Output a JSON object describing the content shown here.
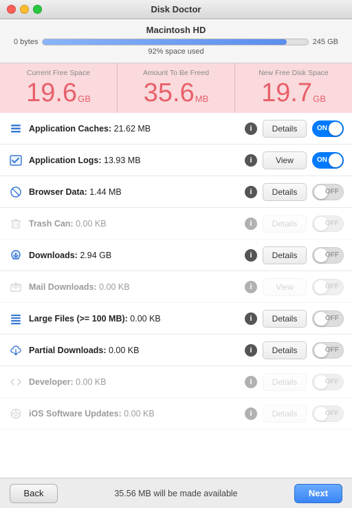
{
  "titlebar": {
    "title": "Disk Doctor"
  },
  "disk": {
    "name": "Macintosh HD",
    "label_left": "0 bytes",
    "label_right": "245 GB",
    "used_percent": 92,
    "used_label": "92% space used",
    "fill_width": "92%"
  },
  "stats": [
    {
      "label": "Current Free Space",
      "value": "19.6",
      "unit": "GB"
    },
    {
      "label": "Amount To Be Freed",
      "value": "35.6",
      "unit": "MB"
    },
    {
      "label": "New Free Disk Space",
      "value": "19.7",
      "unit": "GB"
    }
  ],
  "items": [
    {
      "name": "app-caches",
      "icon": "stack",
      "icon_type": "active",
      "label": "Application Caches:",
      "size": "21.62 MB",
      "btn_label": "Details",
      "btn_active": true,
      "toggle": "on",
      "disabled": false
    },
    {
      "name": "app-logs",
      "icon": "checklist",
      "icon_type": "active",
      "label": "Application Logs:",
      "size": "13.93 MB",
      "btn_label": "View",
      "btn_active": true,
      "toggle": "on",
      "disabled": false
    },
    {
      "name": "browser-data",
      "icon": "slash-circle",
      "icon_type": "active",
      "label": "Browser Data:",
      "size": "1.44 MB",
      "btn_label": "Details",
      "btn_active": true,
      "toggle": "off",
      "disabled": false
    },
    {
      "name": "trash-can",
      "icon": "trash",
      "icon_type": "gray",
      "label": "Trash Can:",
      "size": "0.00 KB",
      "btn_label": "Details",
      "btn_active": false,
      "toggle": "off",
      "disabled": true
    },
    {
      "name": "downloads",
      "icon": "download",
      "icon_type": "active",
      "label": "Downloads:",
      "size": "2.94 GB",
      "btn_label": "Details",
      "btn_active": true,
      "toggle": "off",
      "disabled": false
    },
    {
      "name": "mail-downloads",
      "icon": "mail-download",
      "icon_type": "gray",
      "label": "Mail Downloads:",
      "size": "0.00 KB",
      "btn_label": "View",
      "btn_active": false,
      "toggle": "off",
      "disabled": true
    },
    {
      "name": "large-files",
      "icon": "large-files",
      "icon_type": "active",
      "label": "Large Files (>= 100 MB):",
      "size": "0.00 KB",
      "btn_label": "Details",
      "btn_active": true,
      "toggle": "off",
      "disabled": false
    },
    {
      "name": "partial-downloads",
      "icon": "cloud-download",
      "icon_type": "active",
      "label": "Partial Downloads:",
      "size": "0.00 KB",
      "btn_label": "Details",
      "btn_active": true,
      "toggle": "off",
      "disabled": false
    },
    {
      "name": "developer",
      "icon": "code",
      "icon_type": "gray",
      "label": "Developer:",
      "size": "0.00 KB",
      "btn_label": "Details",
      "btn_active": false,
      "toggle": "off",
      "disabled": true
    },
    {
      "name": "ios-updates",
      "icon": "ios",
      "icon_type": "gray",
      "label": "iOS Software Updates:",
      "size": "0.00 KB",
      "btn_label": "Details",
      "btn_active": false,
      "toggle": "off",
      "disabled": true
    }
  ],
  "bottom": {
    "back_label": "Back",
    "message": "35.56 MB will be made available",
    "next_label": "Next"
  },
  "icons": {
    "stack": "≡",
    "checklist": "☑",
    "slash-circle": "⊘",
    "trash": "🗑",
    "download": "⬇",
    "mail-download": "⬇",
    "large-files": "≡",
    "cloud-download": "☁",
    "code": "</>",
    "ios": "⚙"
  }
}
